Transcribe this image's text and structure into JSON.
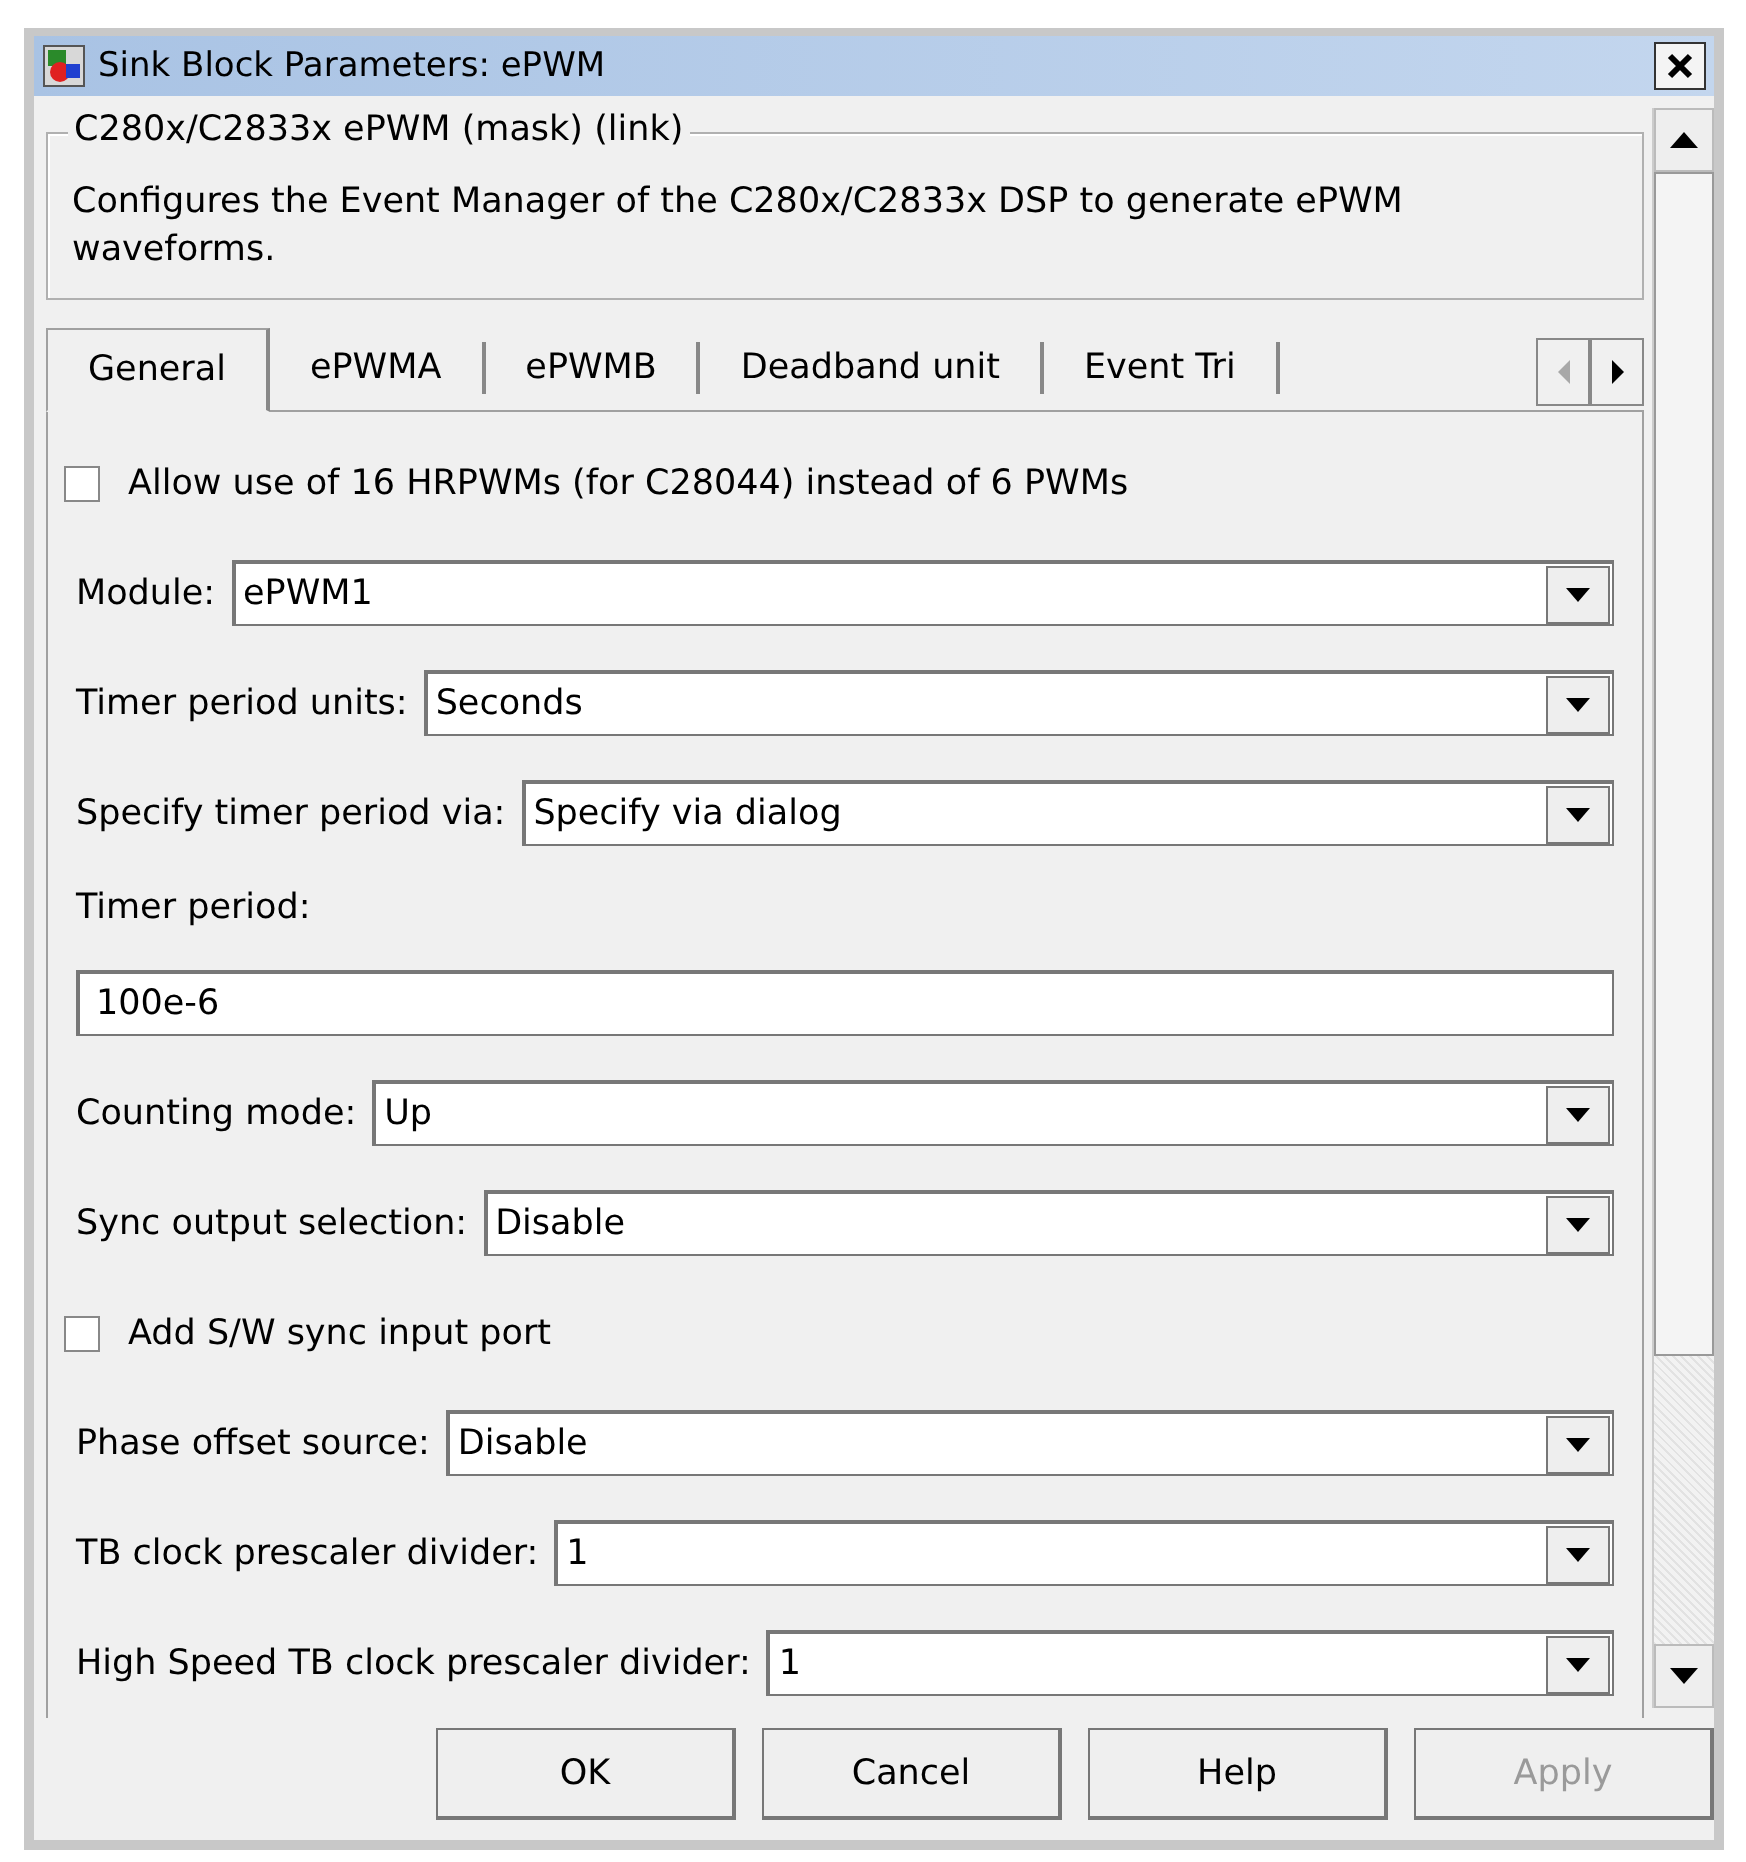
{
  "window": {
    "title": "Sink Block Parameters: ePWM"
  },
  "group": {
    "title": "C280x/C2833x ePWM (mask) (link)",
    "description": "Configures the Event Manager of the C280x/C2833x DSP to generate ePWM waveforms."
  },
  "tabs": [
    {
      "label": "General",
      "selected": true
    },
    {
      "label": "ePWMA",
      "selected": false
    },
    {
      "label": "ePWMB",
      "selected": false
    },
    {
      "label": "Deadband unit",
      "selected": false
    },
    {
      "label": "Event Tri",
      "selected": false
    }
  ],
  "tab_scroll": {
    "left_disabled": true,
    "right_disabled": false
  },
  "params": [
    {
      "kind": "checkbox",
      "label": "Allow use of 16 HRPWMs (for C28044) instead of 6 PWMs",
      "checked": false
    },
    {
      "kind": "dropdown",
      "label": "Module:",
      "value": "ePWM1"
    },
    {
      "kind": "dropdown",
      "label": "Timer period units:",
      "value": "Seconds"
    },
    {
      "kind": "dropdown",
      "label": "Specify timer period via:",
      "value": "Specify via dialog"
    },
    {
      "kind": "edit",
      "label": "Timer period:",
      "value": "100e-6"
    },
    {
      "kind": "dropdown",
      "label": "Counting mode:",
      "value": "Up"
    },
    {
      "kind": "dropdown",
      "label": "Sync output selection:",
      "value": "Disable"
    },
    {
      "kind": "checkbox",
      "label": "Add S/W sync input port",
      "checked": false
    },
    {
      "kind": "dropdown",
      "label": "Phase offset source:",
      "value": "Disable"
    },
    {
      "kind": "dropdown",
      "label": "TB clock prescaler divider:",
      "value": "1"
    },
    {
      "kind": "dropdown",
      "label": "High Speed TB clock prescaler divider:",
      "value": "1"
    }
  ],
  "buttons": [
    {
      "label": "OK",
      "disabled": false
    },
    {
      "label": "Cancel",
      "disabled": false
    },
    {
      "label": "Help",
      "disabled": false
    },
    {
      "label": "Apply",
      "disabled": true
    }
  ]
}
